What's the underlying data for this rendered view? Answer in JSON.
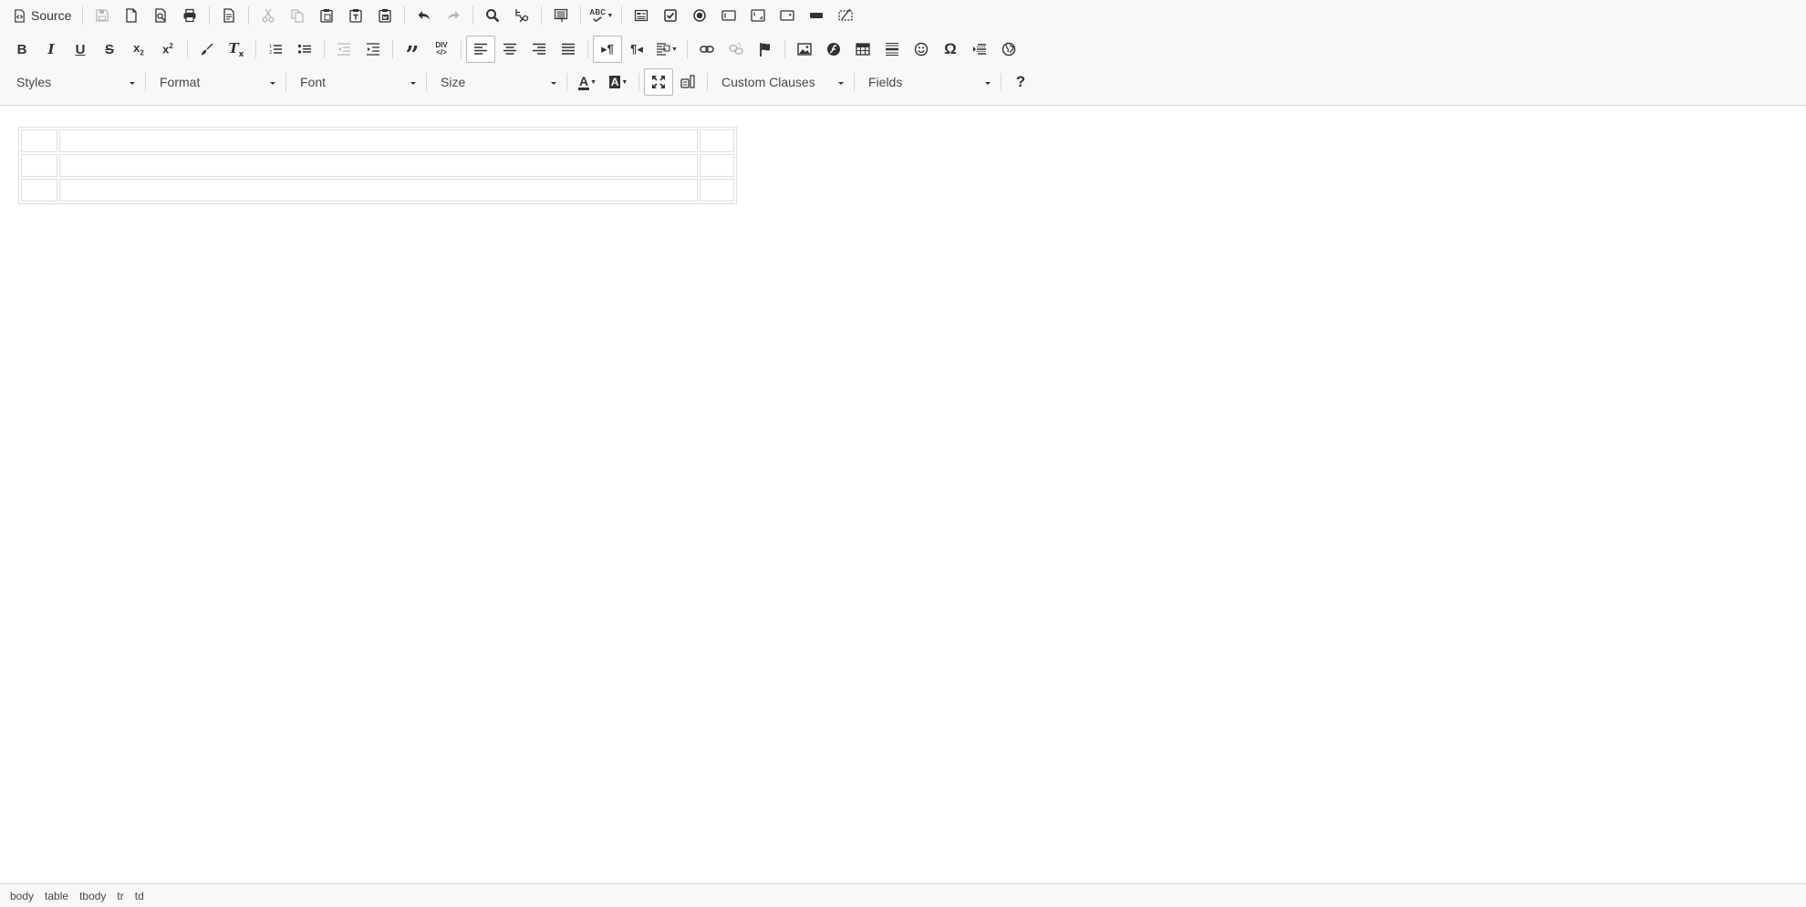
{
  "toolbar": {
    "source_label": "Source",
    "row1": [
      {
        "name": "save-icon",
        "disabled": true
      },
      {
        "name": "new-page-icon",
        "disabled": false
      },
      {
        "name": "preview-icon",
        "disabled": false
      },
      {
        "name": "print-icon",
        "disabled": false
      },
      {
        "name": "templates-icon",
        "disabled": false
      },
      {
        "name": "cut-icon",
        "disabled": true
      },
      {
        "name": "copy-icon",
        "disabled": true
      },
      {
        "name": "paste-icon",
        "disabled": false
      },
      {
        "name": "paste-text-icon",
        "disabled": false
      },
      {
        "name": "paste-word-icon",
        "disabled": false
      },
      {
        "name": "undo-icon",
        "disabled": false
      },
      {
        "name": "redo-icon",
        "disabled": true
      },
      {
        "name": "find-icon",
        "disabled": false
      },
      {
        "name": "replace-icon",
        "disabled": false
      },
      {
        "name": "select-all-icon",
        "disabled": false
      },
      {
        "name": "spellcheck-icon",
        "disabled": false
      },
      {
        "name": "form-icon",
        "disabled": false
      },
      {
        "name": "checkbox-icon",
        "disabled": false
      },
      {
        "name": "radio-icon",
        "disabled": false
      },
      {
        "name": "text-field-icon",
        "disabled": false
      },
      {
        "name": "textarea-icon",
        "disabled": false
      },
      {
        "name": "select-field-icon",
        "disabled": false
      },
      {
        "name": "button-field-icon",
        "disabled": false
      },
      {
        "name": "hidden-field-icon",
        "disabled": false
      }
    ],
    "spellcheck_label": "ABC",
    "style_combos": {
      "styles": "Styles",
      "format": "Format",
      "font": "Font",
      "size": "Size",
      "custom_clauses": "Custom Clauses",
      "fields": "Fields"
    },
    "help_label": "?",
    "blockquote_glyph": "”",
    "omega_glyph": "Ω",
    "div_label_top": "DIV",
    "div_label_bottom": "</>"
  },
  "content": {
    "table_rows": 3
  },
  "elements_path": [
    "body",
    "table",
    "tbody",
    "tr",
    "td"
  ]
}
